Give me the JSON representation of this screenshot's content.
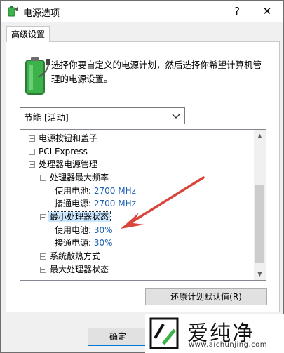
{
  "window": {
    "title": "电源选项",
    "help": "?",
    "close": "✕"
  },
  "tab": {
    "label": "高级设置"
  },
  "description": "选择你要自定义的电源计划，然后选择你希望计算机管理的电源设置。",
  "plan_select": {
    "value": "节能 [活动]"
  },
  "tree": {
    "power_buttons": "电源按钮和盖子",
    "pci_express": "PCI Express",
    "processor_mgmt": "处理器电源管理",
    "max_freq": "处理器最大频率",
    "max_freq_battery": {
      "label": "使用电池:",
      "value": "2700 MHz"
    },
    "max_freq_plugged": {
      "label": "接通电源:",
      "value": "2700 MHz"
    },
    "min_state": "最小处理器状态",
    "min_state_battery": {
      "label": "使用电池:",
      "value": "30%"
    },
    "min_state_plugged": {
      "label": "接通电源:",
      "value": "30%"
    },
    "cooling": "系统散热方式",
    "max_state": "最大处理器状态"
  },
  "buttons": {
    "restore": "还原计划默认值(R)",
    "ok": "确定"
  },
  "watermark": {
    "brand": "爱纯净",
    "url": "www.aichunjing.com"
  },
  "colors": {
    "value_blue": "#1a5fb4",
    "arrow_red": "#d9453b",
    "battery_green": "#3cb34a"
  }
}
